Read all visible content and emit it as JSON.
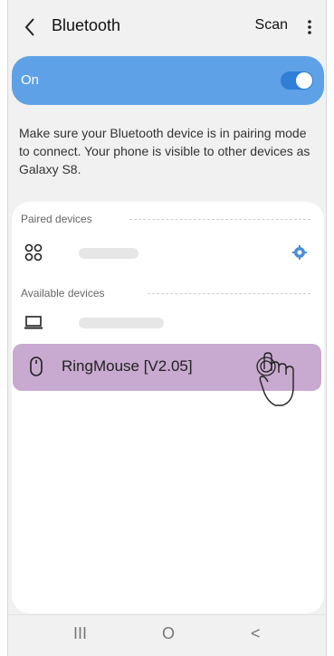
{
  "header": {
    "title": "Bluetooth",
    "scan_label": "Scan",
    "back_icon": "chevron-left-icon",
    "more_icon": "more-vertical-icon"
  },
  "bluetooth_toggle": {
    "label": "On",
    "state": true,
    "accent": "#5ea1e7"
  },
  "description": "Make sure your Bluetooth device is in pairing mode to connect. Your phone is visible to other devices as Galaxy S8.",
  "paired": {
    "section_label": "Paired devices",
    "devices": [
      {
        "icon": "grid-device-icon",
        "name": "",
        "settings_icon": "gear-icon"
      }
    ]
  },
  "available": {
    "section_label": "Available devices",
    "devices": [
      {
        "icon": "laptop-icon",
        "name": ""
      },
      {
        "icon": "mouse-icon",
        "name": "RingMouse [V2.05]",
        "highlighted": true,
        "highlight_color": "#c8a9cf"
      }
    ]
  },
  "navbar": {
    "recent": "III",
    "home": "O",
    "back": "<"
  }
}
